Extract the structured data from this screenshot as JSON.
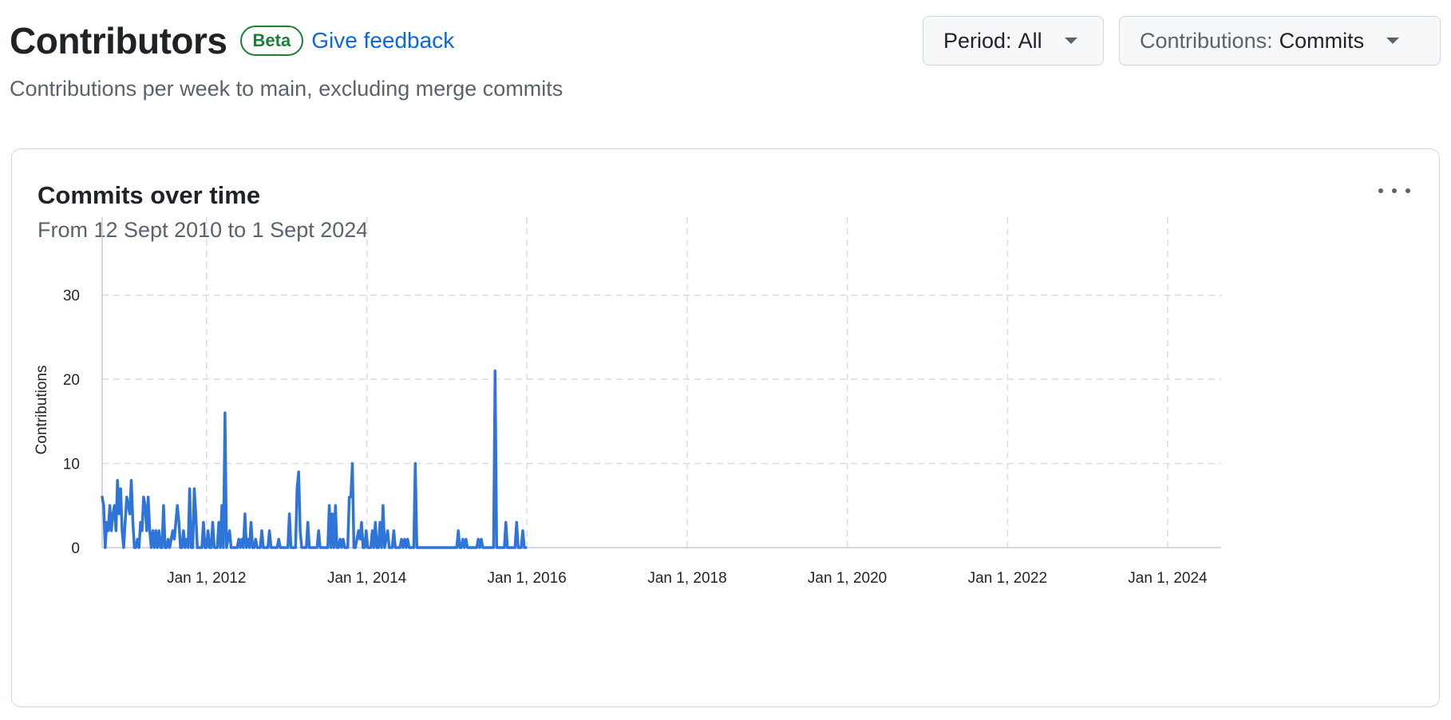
{
  "header": {
    "title": "Contributors",
    "badge": "Beta",
    "feedback_link": "Give feedback",
    "subtitle": "Contributions per week to main, excluding merge commits"
  },
  "filters": {
    "period_label": "Period:",
    "period_value": "All",
    "contributions_label": "Contributions:",
    "contributions_value": "Commits"
  },
  "card": {
    "title": "Commits over time",
    "subtitle": "From 12 Sept 2010 to 1 Sept 2024",
    "menu_icon": "kebab-horizontal-icon"
  },
  "colors": {
    "line": "#2f74d9",
    "grid": "#d8dde3",
    "accent_green": "#1a7f37",
    "link_blue": "#0969da"
  },
  "chart_data": {
    "type": "line",
    "title": "Commits over time",
    "xlabel": "",
    "ylabel": "Contributions",
    "xlim": [
      "2010-09-12",
      "2024-09-01"
    ],
    "ylim": [
      0,
      35
    ],
    "y_ticks": [
      0,
      10,
      20,
      30
    ],
    "x_ticks": [
      {
        "date": "2012-01-01",
        "label": "Jan 1, 2012"
      },
      {
        "date": "2014-01-01",
        "label": "Jan 1, 2014"
      },
      {
        "date": "2016-01-01",
        "label": "Jan 1, 2016"
      },
      {
        "date": "2018-01-01",
        "label": "Jan 1, 2018"
      },
      {
        "date": "2020-01-01",
        "label": "Jan 1, 2020"
      },
      {
        "date": "2022-01-01",
        "label": "Jan 1, 2022"
      },
      {
        "date": "2024-01-01",
        "label": "Jan 1, 2024"
      }
    ],
    "grid": true,
    "legend": "none",
    "series": [
      {
        "values": [
          [
            "2010-09-12",
            6
          ],
          [
            "2010-09-19",
            5
          ],
          [
            "2010-09-26",
            0
          ],
          [
            "2010-10-03",
            3
          ],
          [
            "2010-10-10",
            2
          ],
          [
            "2010-10-17",
            5
          ],
          [
            "2010-10-24",
            2
          ],
          [
            "2010-10-31",
            4
          ],
          [
            "2010-11-07",
            5
          ],
          [
            "2010-11-14",
            2
          ],
          [
            "2010-11-21",
            8
          ],
          [
            "2010-11-28",
            4
          ],
          [
            "2010-12-05",
            7
          ],
          [
            "2010-12-12",
            2
          ],
          [
            "2010-12-19",
            0
          ],
          [
            "2010-12-26",
            3
          ],
          [
            "2011-01-02",
            6
          ],
          [
            "2011-01-09",
            5
          ],
          [
            "2011-01-16",
            4
          ],
          [
            "2011-01-23",
            8
          ],
          [
            "2011-01-30",
            3
          ],
          [
            "2011-02-06",
            0
          ],
          [
            "2011-02-13",
            0
          ],
          [
            "2011-02-20",
            1
          ],
          [
            "2011-02-27",
            0
          ],
          [
            "2011-03-06",
            3
          ],
          [
            "2011-03-13",
            2
          ],
          [
            "2011-03-20",
            6
          ],
          [
            "2011-03-27",
            5
          ],
          [
            "2011-04-03",
            2
          ],
          [
            "2011-04-10",
            6
          ],
          [
            "2011-04-17",
            2
          ],
          [
            "2011-04-24",
            0
          ],
          [
            "2011-05-01",
            2
          ],
          [
            "2011-05-08",
            0
          ],
          [
            "2011-05-15",
            2
          ],
          [
            "2011-05-22",
            0
          ],
          [
            "2011-05-29",
            2
          ],
          [
            "2011-06-05",
            0
          ],
          [
            "2011-06-12",
            0
          ],
          [
            "2011-06-19",
            5
          ],
          [
            "2011-06-26",
            0
          ],
          [
            "2011-07-03",
            0
          ],
          [
            "2011-07-10",
            1
          ],
          [
            "2011-07-17",
            0
          ],
          [
            "2011-07-24",
            1
          ],
          [
            "2011-07-31",
            2
          ],
          [
            "2011-08-07",
            1
          ],
          [
            "2011-08-14",
            3
          ],
          [
            "2011-08-21",
            5
          ],
          [
            "2011-08-28",
            3
          ],
          [
            "2011-09-04",
            0
          ],
          [
            "2011-09-11",
            0
          ],
          [
            "2011-09-18",
            2
          ],
          [
            "2011-09-25",
            0
          ],
          [
            "2011-10-02",
            1
          ],
          [
            "2011-10-09",
            0
          ],
          [
            "2011-10-16",
            7
          ],
          [
            "2011-10-23",
            0
          ],
          [
            "2011-10-30",
            0
          ],
          [
            "2011-11-06",
            7
          ],
          [
            "2011-11-13",
            4
          ],
          [
            "2011-11-20",
            0
          ],
          [
            "2011-11-27",
            0
          ],
          [
            "2011-12-04",
            0
          ],
          [
            "2011-12-11",
            0
          ],
          [
            "2011-12-18",
            3
          ],
          [
            "2011-12-25",
            0
          ],
          [
            "2012-01-01",
            0
          ],
          [
            "2012-01-08",
            2
          ],
          [
            "2012-01-15",
            0
          ],
          [
            "2012-01-22",
            0
          ],
          [
            "2012-01-29",
            3
          ],
          [
            "2012-02-05",
            0
          ],
          [
            "2012-02-12",
            0
          ],
          [
            "2012-02-19",
            0
          ],
          [
            "2012-02-26",
            3
          ],
          [
            "2012-03-04",
            0
          ],
          [
            "2012-03-11",
            5
          ],
          [
            "2012-03-18",
            0
          ],
          [
            "2012-03-25",
            16
          ],
          [
            "2012-04-01",
            0
          ],
          [
            "2012-04-08",
            1
          ],
          [
            "2012-04-15",
            2
          ],
          [
            "2012-04-22",
            0
          ],
          [
            "2012-04-29",
            0
          ],
          [
            "2012-05-06",
            0
          ],
          [
            "2012-05-13",
            0
          ],
          [
            "2012-05-20",
            0
          ],
          [
            "2012-05-27",
            1
          ],
          [
            "2012-06-03",
            0
          ],
          [
            "2012-06-10",
            1
          ],
          [
            "2012-06-17",
            0
          ],
          [
            "2012-06-24",
            4
          ],
          [
            "2012-07-01",
            0
          ],
          [
            "2012-07-08",
            1
          ],
          [
            "2012-07-15",
            0
          ],
          [
            "2012-07-22",
            3
          ],
          [
            "2012-07-29",
            0
          ],
          [
            "2012-08-05",
            0
          ],
          [
            "2012-08-12",
            1
          ],
          [
            "2012-08-19",
            0
          ],
          [
            "2012-08-26",
            0
          ],
          [
            "2012-09-02",
            0
          ],
          [
            "2012-09-09",
            2
          ],
          [
            "2012-09-16",
            0
          ],
          [
            "2012-09-23",
            0
          ],
          [
            "2012-09-30",
            0
          ],
          [
            "2012-10-07",
            0
          ],
          [
            "2012-10-14",
            2
          ],
          [
            "2012-10-21",
            0
          ],
          [
            "2012-10-28",
            0
          ],
          [
            "2012-11-04",
            0
          ],
          [
            "2012-11-11",
            0
          ],
          [
            "2012-11-18",
            0
          ],
          [
            "2012-11-25",
            1
          ],
          [
            "2012-12-02",
            0
          ],
          [
            "2012-12-09",
            0
          ],
          [
            "2012-12-16",
            0
          ],
          [
            "2012-12-23",
            0
          ],
          [
            "2012-12-30",
            0
          ],
          [
            "2013-01-06",
            0
          ],
          [
            "2013-01-13",
            4
          ],
          [
            "2013-01-20",
            0
          ],
          [
            "2013-01-27",
            0
          ],
          [
            "2013-02-03",
            0
          ],
          [
            "2013-02-10",
            0
          ],
          [
            "2013-02-17",
            7
          ],
          [
            "2013-02-24",
            9
          ],
          [
            "2013-03-03",
            2
          ],
          [
            "2013-03-10",
            0
          ],
          [
            "2013-03-17",
            0
          ],
          [
            "2013-03-24",
            0
          ],
          [
            "2013-03-31",
            0
          ],
          [
            "2013-04-07",
            3
          ],
          [
            "2013-04-14",
            0
          ],
          [
            "2013-04-21",
            0
          ],
          [
            "2013-04-28",
            0
          ],
          [
            "2013-05-05",
            0
          ],
          [
            "2013-05-12",
            0
          ],
          [
            "2013-05-19",
            0
          ],
          [
            "2013-05-26",
            2
          ],
          [
            "2013-06-02",
            0
          ],
          [
            "2013-06-09",
            0
          ],
          [
            "2013-06-16",
            0
          ],
          [
            "2013-06-23",
            0
          ],
          [
            "2013-06-30",
            0
          ],
          [
            "2013-07-07",
            0
          ],
          [
            "2013-07-14",
            5
          ],
          [
            "2013-07-21",
            0
          ],
          [
            "2013-07-28",
            4
          ],
          [
            "2013-08-04",
            0
          ],
          [
            "2013-08-11",
            5
          ],
          [
            "2013-08-18",
            0
          ],
          [
            "2013-08-25",
            0
          ],
          [
            "2013-09-01",
            1
          ],
          [
            "2013-09-08",
            0
          ],
          [
            "2013-09-15",
            1
          ],
          [
            "2013-09-22",
            0
          ],
          [
            "2013-09-29",
            0
          ],
          [
            "2013-10-06",
            0
          ],
          [
            "2013-10-13",
            6
          ],
          [
            "2013-10-20",
            6
          ],
          [
            "2013-10-27",
            10
          ],
          [
            "2013-11-03",
            0
          ],
          [
            "2013-11-10",
            0
          ],
          [
            "2013-11-17",
            1
          ],
          [
            "2013-11-24",
            2
          ],
          [
            "2013-12-01",
            1
          ],
          [
            "2013-12-08",
            3
          ],
          [
            "2013-12-15",
            0
          ],
          [
            "2013-12-22",
            0
          ],
          [
            "2013-12-29",
            2
          ],
          [
            "2014-01-05",
            0
          ],
          [
            "2014-01-12",
            0
          ],
          [
            "2014-01-19",
            0
          ],
          [
            "2014-01-26",
            2
          ],
          [
            "2014-02-02",
            0
          ],
          [
            "2014-02-09",
            3
          ],
          [
            "2014-02-16",
            0
          ],
          [
            "2014-02-23",
            0
          ],
          [
            "2014-03-02",
            3
          ],
          [
            "2014-03-09",
            0
          ],
          [
            "2014-03-16",
            5
          ],
          [
            "2014-03-23",
            0
          ],
          [
            "2014-03-30",
            1
          ],
          [
            "2014-04-06",
            2
          ],
          [
            "2014-04-13",
            0
          ],
          [
            "2014-04-20",
            0
          ],
          [
            "2014-04-27",
            0
          ],
          [
            "2014-05-04",
            2
          ],
          [
            "2014-05-11",
            0
          ],
          [
            "2014-05-18",
            0
          ],
          [
            "2014-05-25",
            0
          ],
          [
            "2014-06-01",
            0
          ],
          [
            "2014-06-08",
            1
          ],
          [
            "2014-06-15",
            0
          ],
          [
            "2014-06-22",
            1
          ],
          [
            "2014-06-29",
            0
          ],
          [
            "2014-07-06",
            1
          ],
          [
            "2014-07-13",
            0
          ],
          [
            "2014-07-20",
            0
          ],
          [
            "2014-07-27",
            0
          ],
          [
            "2014-08-03",
            0
          ],
          [
            "2014-08-10",
            10
          ],
          [
            "2014-08-17",
            0
          ],
          [
            "2014-08-24",
            0
          ],
          [
            "2014-08-31",
            0
          ],
          [
            "2014-09-07",
            0
          ],
          [
            "2014-09-14",
            0
          ],
          [
            "2014-09-21",
            0
          ],
          [
            "2014-09-28",
            0
          ],
          [
            "2014-10-05",
            0
          ],
          [
            "2014-10-12",
            0
          ],
          [
            "2014-10-19",
            0
          ],
          [
            "2014-10-26",
            0
          ],
          [
            "2014-11-02",
            0
          ],
          [
            "2014-11-09",
            0
          ],
          [
            "2014-11-16",
            0
          ],
          [
            "2014-11-23",
            0
          ],
          [
            "2014-11-30",
            0
          ],
          [
            "2014-12-07",
            0
          ],
          [
            "2014-12-14",
            0
          ],
          [
            "2014-12-21",
            0
          ],
          [
            "2014-12-28",
            0
          ],
          [
            "2015-01-04",
            0
          ],
          [
            "2015-01-11",
            0
          ],
          [
            "2015-01-18",
            0
          ],
          [
            "2015-01-25",
            0
          ],
          [
            "2015-02-01",
            0
          ],
          [
            "2015-02-08",
            0
          ],
          [
            "2015-02-15",
            0
          ],
          [
            "2015-02-22",
            2
          ],
          [
            "2015-03-01",
            0
          ],
          [
            "2015-03-08",
            0
          ],
          [
            "2015-03-15",
            1
          ],
          [
            "2015-03-22",
            0
          ],
          [
            "2015-03-29",
            1
          ],
          [
            "2015-04-05",
            0
          ],
          [
            "2015-04-12",
            0
          ],
          [
            "2015-04-19",
            0
          ],
          [
            "2015-04-26",
            0
          ],
          [
            "2015-05-03",
            0
          ],
          [
            "2015-05-10",
            0
          ],
          [
            "2015-05-17",
            0
          ],
          [
            "2015-05-24",
            1
          ],
          [
            "2015-05-31",
            0
          ],
          [
            "2015-06-07",
            1
          ],
          [
            "2015-06-14",
            0
          ],
          [
            "2015-06-21",
            0
          ],
          [
            "2015-06-28",
            0
          ],
          [
            "2015-07-05",
            0
          ],
          [
            "2015-07-12",
            0
          ],
          [
            "2015-07-19",
            0
          ],
          [
            "2015-07-26",
            0
          ],
          [
            "2015-08-02",
            0
          ],
          [
            "2015-08-09",
            21
          ],
          [
            "2015-08-16",
            0
          ],
          [
            "2015-08-23",
            0
          ],
          [
            "2015-08-30",
            0
          ],
          [
            "2015-09-06",
            0
          ],
          [
            "2015-09-13",
            0
          ],
          [
            "2015-09-20",
            0
          ],
          [
            "2015-09-27",
            3
          ],
          [
            "2015-10-04",
            0
          ],
          [
            "2015-10-11",
            0
          ],
          [
            "2015-10-18",
            0
          ],
          [
            "2015-10-25",
            0
          ],
          [
            "2015-11-01",
            0
          ],
          [
            "2015-11-08",
            0
          ],
          [
            "2015-11-15",
            3
          ],
          [
            "2015-11-22",
            0
          ],
          [
            "2015-11-29",
            0
          ],
          [
            "2015-12-06",
            0
          ],
          [
            "2015-12-13",
            2
          ],
          [
            "2015-12-20",
            0
          ],
          [
            "2015-12-27",
            0
          ]
        ]
      }
    ]
  }
}
